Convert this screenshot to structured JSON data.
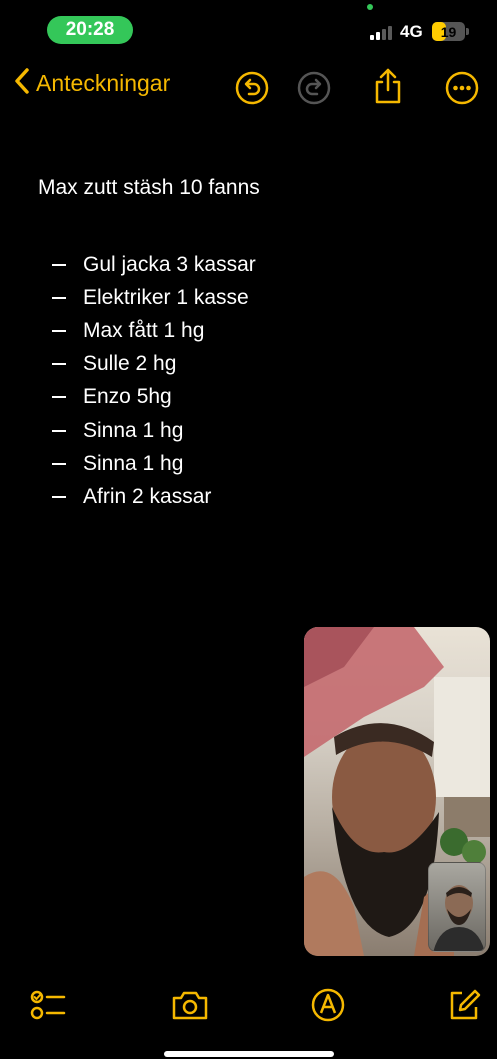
{
  "status_bar": {
    "time": "20:28",
    "network": "4G",
    "battery_level": "19",
    "battery_fraction": 0.19,
    "signal_bars_active": 2,
    "signal_bars_total": 4
  },
  "nav": {
    "back_label": "Anteckningar",
    "icons": [
      "chevron-left-icon",
      "undo-icon",
      "redo-icon",
      "share-icon",
      "more-icon"
    ]
  },
  "note": {
    "title": "Max zutt stäsh 10 fanns",
    "items": [
      "Gul jacka 3 kassar",
      "Elektriker 1 kasse",
      "Max fått 1 hg",
      "Sulle 2 hg",
      "Enzo 5hg",
      "Sinna 1 hg",
      "Sinna 1 hg",
      "Afrin 2 kassar"
    ]
  },
  "toolbar": {
    "icons": [
      "checklist-icon",
      "camera-icon",
      "markup-icon",
      "compose-icon"
    ]
  },
  "colors": {
    "accent": "#f5b800",
    "status_green": "#34c759",
    "background": "#000000",
    "text": "#ffffff"
  }
}
